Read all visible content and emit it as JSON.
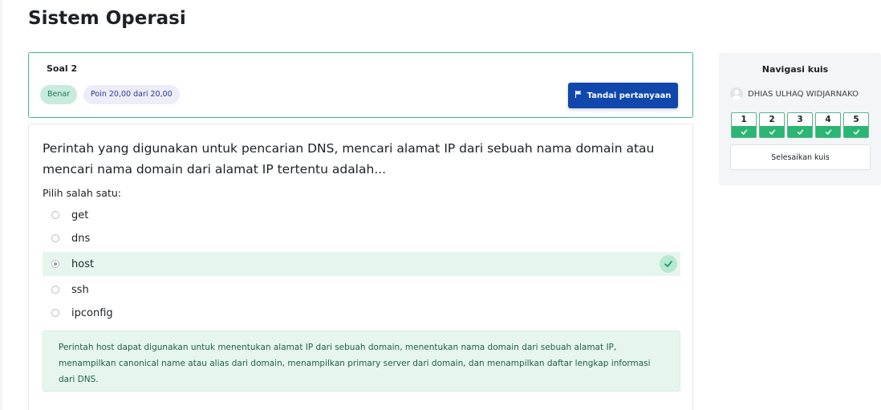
{
  "page": {
    "title": "Sistem Operasi"
  },
  "question_info": {
    "number": "Soal 2",
    "state_badge": "Benar",
    "grade_badge": "Poin 20,00 dari 20,00",
    "flag_button": "Tandai pertanyaan",
    "flag_icon": "flag-icon"
  },
  "question": {
    "text": "Perintah yang digunakan untuk pencarian DNS, mencari alamat IP dari sebuah nama domain atau mencari nama domain dari alamat IP tertentu adalah...",
    "prompt": "Pilih salah satu:",
    "options": [
      {
        "label": "get",
        "checked": false,
        "correct": false
      },
      {
        "label": "dns",
        "checked": false,
        "correct": false
      },
      {
        "label": "host",
        "checked": true,
        "correct": true
      },
      {
        "label": "ssh",
        "checked": false,
        "correct": false
      },
      {
        "label": "ipconfig",
        "checked": false,
        "correct": false
      }
    ],
    "correct_icon": "check-icon",
    "feedback": "Perintah host dapat digunakan untuk menentukan alamat IP dari sebuah domain, menentukan nama domain dari sebuah alamat IP, menampilkan canonical name atau alias dari domain, menampilkan primary server dari domain, dan menampilkan daftar lengkap informasi dari DNS."
  },
  "quiz_nav": {
    "title": "Navigasi kuis",
    "user_name": "DHIAS ULHAQ WIDJARNAKO",
    "buttons": [
      {
        "number": "1",
        "state": "correct"
      },
      {
        "number": "2",
        "state": "correct"
      },
      {
        "number": "3",
        "state": "correct"
      },
      {
        "number": "4",
        "state": "correct"
      },
      {
        "number": "5",
        "state": "correct"
      }
    ],
    "finish_button": "Selesaikan kuis"
  },
  "colors": {
    "accent": "#0f47ad",
    "correct": "#2bb673",
    "correct_bg": "#e6f6ef"
  }
}
